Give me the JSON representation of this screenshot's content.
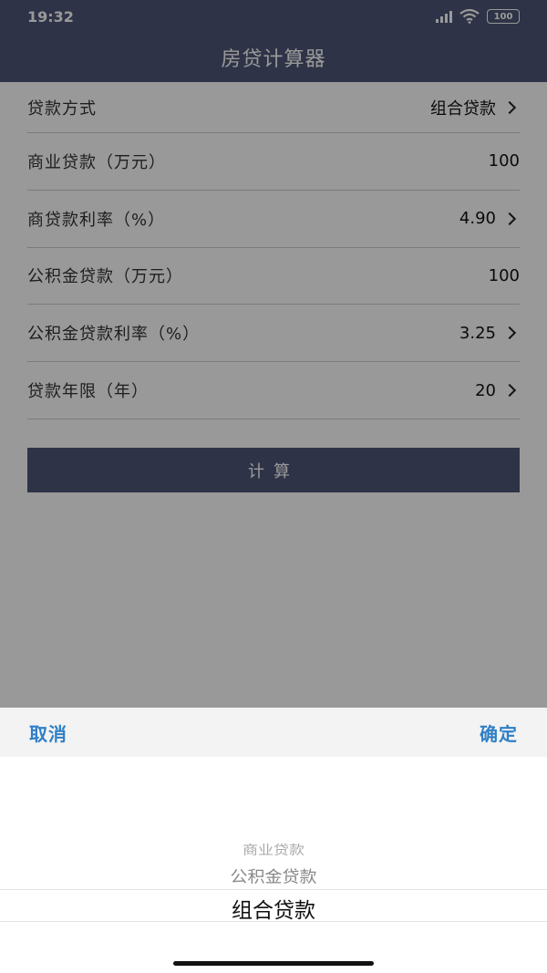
{
  "status": {
    "time": "19:32",
    "battery": "100"
  },
  "header": {
    "title": "房贷计算器"
  },
  "form": {
    "rows": [
      {
        "label": "贷款方式",
        "value": "组合贷款",
        "chevron": true
      },
      {
        "label": "商业贷款（万元）",
        "value": "100",
        "chevron": false
      },
      {
        "label": "商贷款利率（%）",
        "value": "4.90",
        "chevron": true
      },
      {
        "label": "公积金贷款（万元）",
        "value": "100",
        "chevron": false
      },
      {
        "label": "公积金贷款利率（%）",
        "value": "3.25",
        "chevron": true
      },
      {
        "label": "贷款年限（年）",
        "value": "20",
        "chevron": true
      }
    ],
    "calculate_label": "计算"
  },
  "picker": {
    "cancel_label": "取消",
    "confirm_label": "确定",
    "options": [
      "商业贷款",
      "公积金贷款",
      "组合贷款"
    ],
    "selected": "组合贷款"
  },
  "colors": {
    "header": "#4e5677",
    "accent": "#2f7fc6"
  }
}
